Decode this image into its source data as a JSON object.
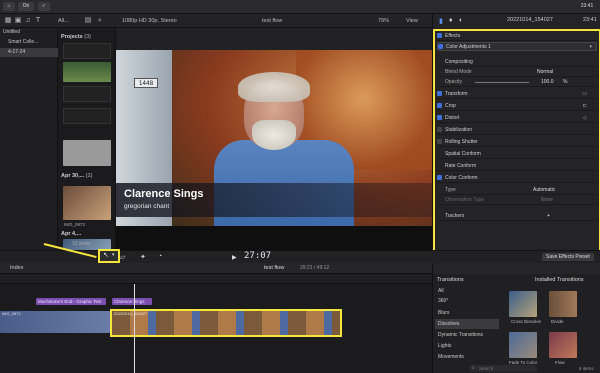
{
  "toolbar": {
    "btn1": "⌂",
    "btn2": "On",
    "btn3": "✓",
    "timecode_right": "23:41"
  },
  "library": {
    "filter": "All...",
    "format": "1080p HD 30p, Stereo",
    "project_title": "test flow",
    "zoom": "79%",
    "view": "View",
    "inspector_title": "20221014_154027"
  },
  "sidebar": {
    "items": [
      "Untitled",
      "Smart Colle...",
      "4-17-24"
    ]
  },
  "browser": {
    "projects_header": "Projects",
    "projects_count": "(3)",
    "group2": "Apr 30,...",
    "group2_count": "(2)",
    "group3": "Apr 4,...",
    "clip_label": "IMG_0872",
    "footer": "10 items"
  },
  "viewer": {
    "title_main": "Clarence Sings",
    "title_sub": "gregorian chant",
    "sign": "1448",
    "timecode": "27:07",
    "play_icon": "▶"
  },
  "inspector": {
    "effects": "Effects",
    "color_adj": "Color Adjustments 1",
    "compositing": "Compositing",
    "blend_mode": "Blend Mode",
    "blend_val": "Normal",
    "opacity": "Opacity",
    "opacity_val": "100.0",
    "opacity_unit": "%",
    "transform": "Transform",
    "crop": "Crop",
    "distort": "Distort",
    "stabilization": "Stabilization",
    "rolling": "Rolling Shutter",
    "spatial": "Spatial Conform",
    "rate": "Rate Conform",
    "color_conform": "Color Conform",
    "type": "Type",
    "type_val": "Automatic",
    "obs_type": "Observation Type",
    "obs_val": "None",
    "trackers": "Trackers",
    "plus": "+",
    "save_preset": "Save Effects Preset"
  },
  "timeline": {
    "index": "Index",
    "project": "test flow",
    "duration": "29:21 / 49:12",
    "title_clip": "Muchstone's End - Graphic Text",
    "title_clip2": "Clarence Sings",
    "clip_a": "IMG_0872",
    "clip_b": "20221014_154027"
  },
  "transitions": {
    "header": "Transitions",
    "installed": "Installed Transitions",
    "categories": [
      "All",
      "360°",
      "Blurs",
      "Dissolves",
      "Dynamic Transitions",
      "Lights",
      "Movements"
    ],
    "items": [
      "Cross Dissolve",
      "Divide",
      "Fade To Color",
      "Flow"
    ],
    "search_placeholder": "Search",
    "count": "8 items"
  },
  "colors": {
    "highlight": "#f5e53d",
    "accent": "#3f6fd8",
    "title_clip": "#7b4fb0",
    "video_clip": "#3c4f8c"
  }
}
